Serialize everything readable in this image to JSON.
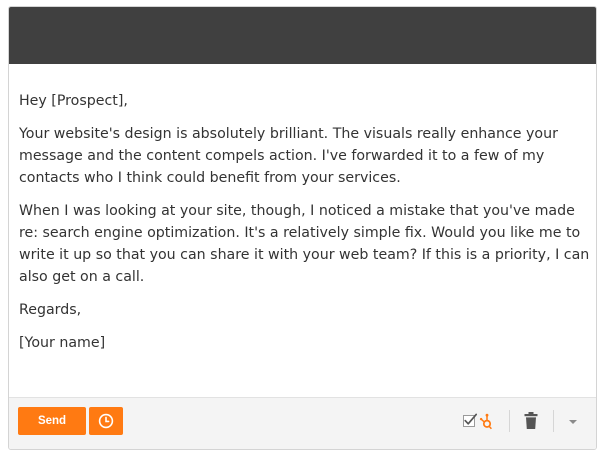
{
  "email": {
    "greeting": "Hey [Prospect],",
    "paragraph_1": "Your website's design is absolutely brilliant. The visuals really enhance your message and the content compels action. I've forwarded it to a few of my contacts who I think could benefit from your services.",
    "paragraph_2": "When I was looking at your site, though, I noticed a mistake that you've made re: search engine optimization. It's a relatively simple fix. Would you like me to write it up so that you can share it with your web team? If this is a priority, I can also get on a call.",
    "closing": "Regards,",
    "signature": "[Your name]"
  },
  "footer": {
    "send_label": "Send",
    "schedule_icon": "clock-icon",
    "track_icon": "checkmark-icon",
    "hubspot_icon": "hubspot-sprocket-icon",
    "trash_icon": "trash-icon",
    "more_icon": "caret-down-icon"
  },
  "colors": {
    "title_bar": "#404040",
    "accent": "#ff7a12",
    "text": "#333333",
    "footer_bg": "#f4f4f4"
  }
}
